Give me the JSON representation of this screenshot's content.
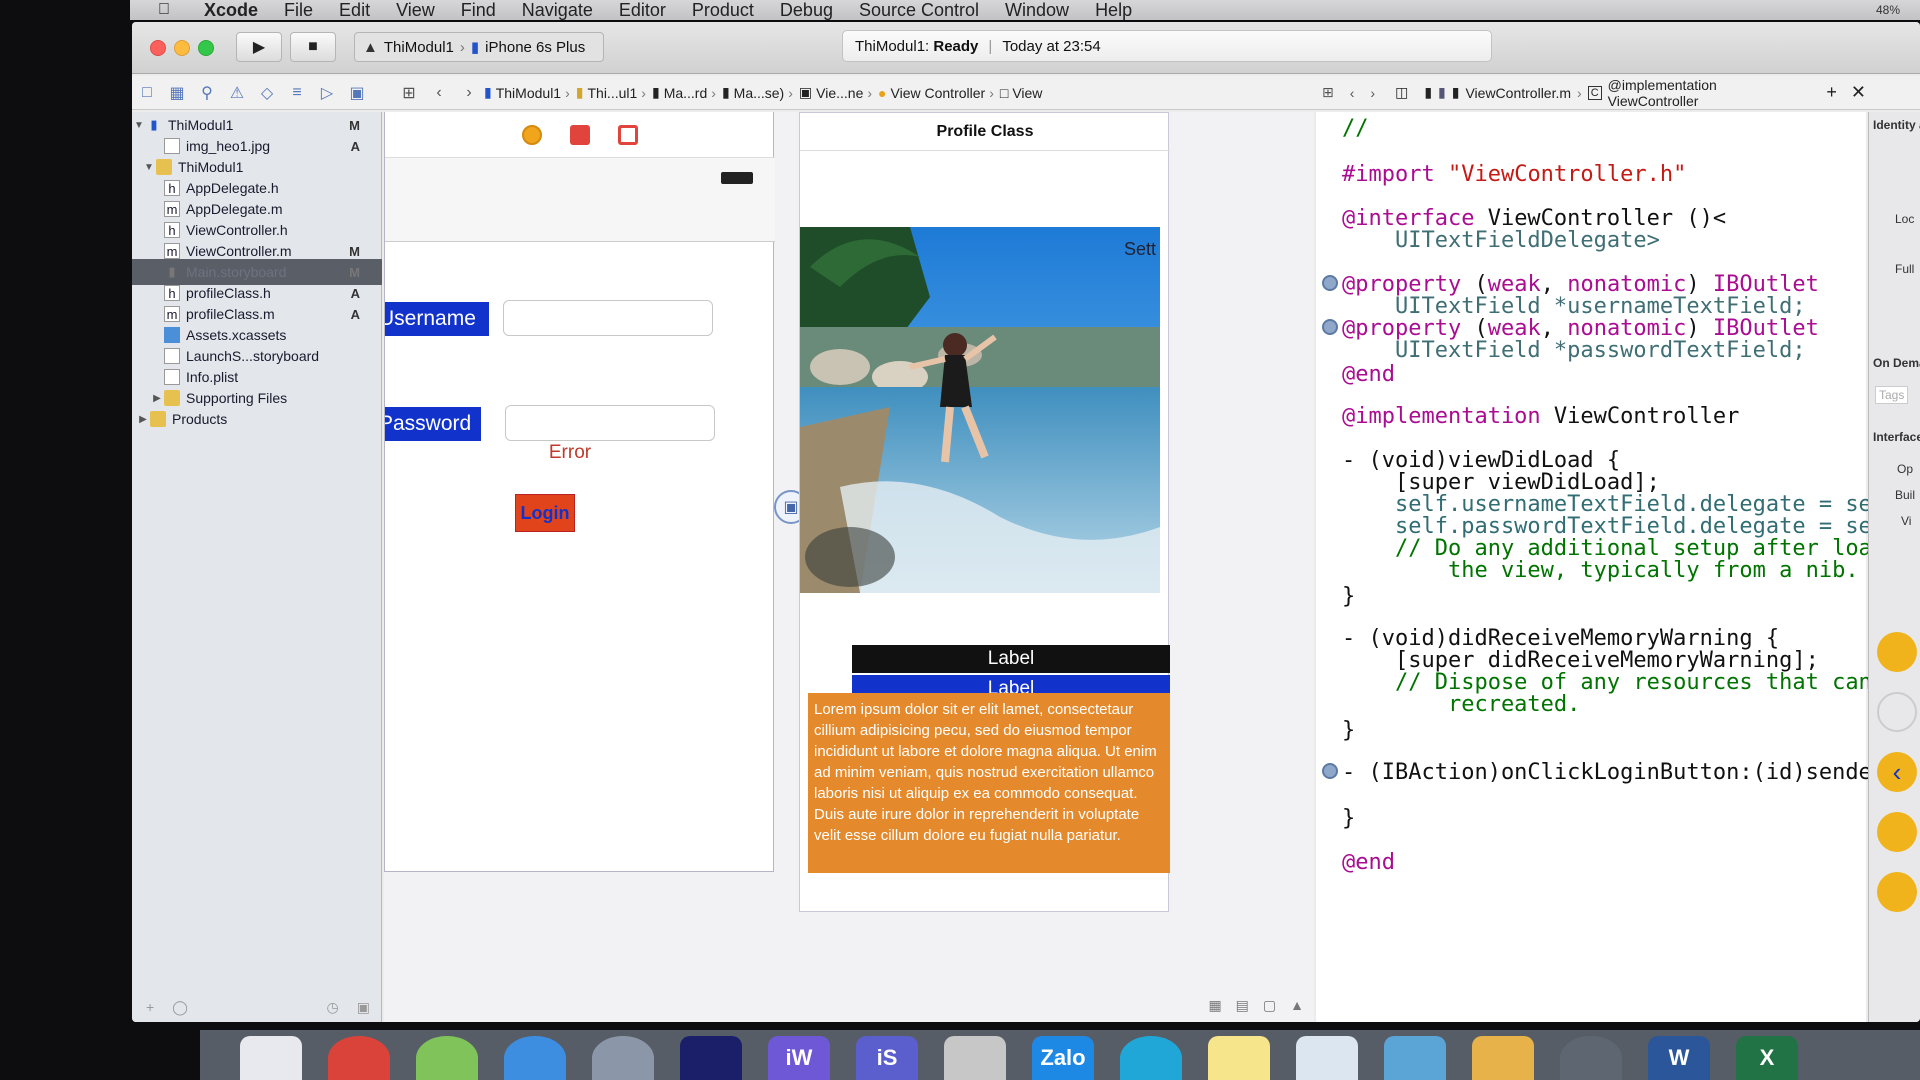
{
  "menubar": {
    "app": "Xcode",
    "items": [
      "File",
      "Edit",
      "View",
      "Find",
      "Navigate",
      "Editor",
      "Product",
      "Debug",
      "Source Control",
      "Window",
      "Help"
    ],
    "status": "48%"
  },
  "toolbar": {
    "scheme": "ThiModul1",
    "device": "iPhone 6s Plus",
    "status_project": "ThiModul1:",
    "status_state": "Ready",
    "status_time": "Today at 23:54"
  },
  "jumpbar": {
    "crumbs": [
      "ThiModul1",
      "Thi...ul1",
      "Ma...rd",
      "Ma...se)",
      "Vie...ne",
      "View Controller",
      "View"
    ]
  },
  "editor_jumpbar": {
    "file": "ViewController.m",
    "symbol": "@implementation ViewController"
  },
  "navigator": {
    "items": [
      {
        "label": "ThiModul1",
        "badge": "M"
      },
      {
        "label": "img_heo1.jpg",
        "badge": "A"
      },
      {
        "label": "ThiModul1",
        "badge": ""
      },
      {
        "label": "AppDelegate.h",
        "badge": ""
      },
      {
        "label": "AppDelegate.m",
        "badge": ""
      },
      {
        "label": "ViewController.h",
        "badge": ""
      },
      {
        "label": "ViewController.m",
        "badge": "M"
      },
      {
        "label": "Main.storyboard",
        "badge": "M"
      },
      {
        "label": "profileClass.h",
        "badge": "A"
      },
      {
        "label": "profileClass.m",
        "badge": "A"
      },
      {
        "label": "Assets.xcassets",
        "badge": ""
      },
      {
        "label": "LaunchS...storyboard",
        "badge": ""
      },
      {
        "label": "Info.plist",
        "badge": ""
      },
      {
        "label": "Supporting Files",
        "badge": ""
      },
      {
        "label": "Products",
        "badge": ""
      }
    ]
  },
  "login_scene": {
    "username_label": "Username",
    "password_label": "Password",
    "error_label": "Error",
    "login_button": "Login"
  },
  "profile_scene": {
    "title": "Profile Class",
    "photo_overlay": "Sett",
    "label1": "Label",
    "label2": "Label",
    "lorem": "Lorem ipsum dolor sit er elit lamet, consectetaur cillium adipisicing pecu, sed do eiusmod tempor incididunt ut labore et dolore magna aliqua. Ut enim ad minim veniam, quis nostrud exercitation ullamco laboris nisi ut aliquip ex ea commodo consequat. Duis aute irure dolor in reprehenderit in voluptate velit esse cillum dolore eu fugiat nulla pariatur."
  },
  "code": {
    "l0": "//",
    "l1": "#import",
    "l1s": "\"ViewController.h\"",
    "l2": "@interface",
    "l2b": " ViewController ()<",
    "l3": "    UITextFieldDelegate>",
    "l4k": "@property",
    "l4a": " (",
    "l4b": "weak",
    "l4c": ", ",
    "l4d": "nonatomic",
    "l4e": ") ",
    "l4f": "IBOutlet",
    "l5": "    UITextField *usernameTextField;",
    "l7": "    UITextField *passwordTextField;",
    "l8": "@end",
    "l9k": "@implementation",
    "l9b": " ViewController",
    "l10": "- (void)viewDidLoad {",
    "l11": "    [super viewDidLoad];",
    "l12": "    self.usernameTextField.delegate = self;",
    "l13": "    self.passwordTextField.delegate = self;",
    "l14": "    // Do any additional setup after loading",
    "l15": "        the view, typically from a nib.",
    "l16": "}",
    "l17": "- (void)didReceiveMemoryWarning {",
    "l18": "    [super didReceiveMemoryWarning];",
    "l19": "    // Dispose of any resources that can be",
    "l20": "        recreated.",
    "l21": "}",
    "l22": "- (IBAction)onClickLoginButton:(id)sender {",
    "l23": "}",
    "l24": "@end"
  },
  "inspector": {
    "identity": "Identity a",
    "loc": "Loc",
    "full": "Full",
    "on_demand": "On Deman",
    "tags": "Tags",
    "interface": "Interface",
    "op": "Op",
    "buil": "Buil",
    "vi": "Vi"
  },
  "dock": {
    "zalo": "Zalo",
    "iw": "iW",
    "is": "iS",
    "w": "W",
    "x": "X"
  }
}
